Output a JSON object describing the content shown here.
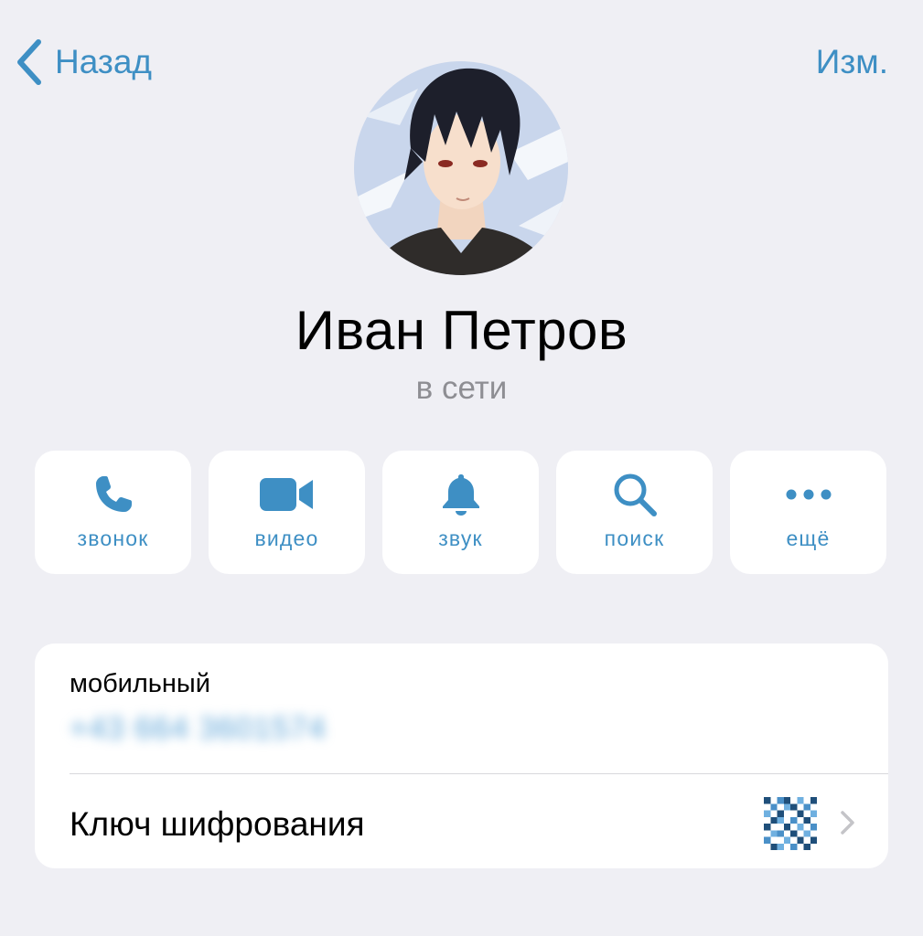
{
  "nav": {
    "back_label": "Назад",
    "edit_label": "Изм."
  },
  "profile": {
    "name": "Иван Петров",
    "status": "в сети"
  },
  "actions": [
    {
      "label": "звонок",
      "icon": "phone-icon"
    },
    {
      "label": "видео",
      "icon": "video-camera-icon"
    },
    {
      "label": "звук",
      "icon": "bell-icon"
    },
    {
      "label": "поиск",
      "icon": "search-icon"
    },
    {
      "label": "ещё",
      "icon": "more-dots-icon"
    }
  ],
  "info": {
    "phone_label": "мобильный",
    "phone_number": "+43 664 3601574",
    "encryption_key_label": "Ключ шифрования"
  },
  "colors": {
    "accent": "#3e8fc4",
    "background": "#efeff4",
    "card": "#ffffff",
    "secondary_text": "#8e8e93"
  }
}
